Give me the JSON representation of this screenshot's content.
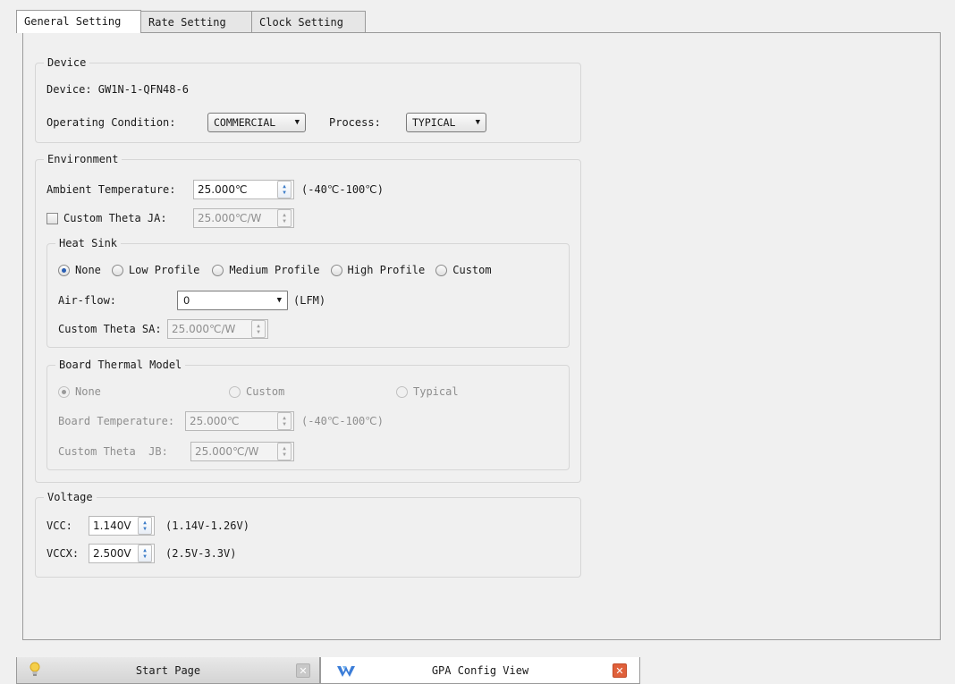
{
  "tabs": [
    {
      "label": "General Setting"
    },
    {
      "label": "Rate Setting"
    },
    {
      "label": "Clock Setting"
    }
  ],
  "device": {
    "title": "Device",
    "device_text": "Device: GW1N-1-QFN48-6",
    "operating_label": "Operating Condition:",
    "operating_value": "COMMERCIAL",
    "process_label": "Process:",
    "process_value": "TYPICAL"
  },
  "environment": {
    "title": "Environment",
    "ambient_label": "Ambient Temperature:",
    "ambient_value": "25.000℃",
    "ambient_range": "(-40℃-100℃)",
    "theta_ja_label": "Custom Theta JA:",
    "theta_ja_value": "25.000℃/W",
    "heat_sink": {
      "title": "Heat Sink",
      "options": [
        "None",
        "Low Profile",
        "Medium Profile",
        "High Profile",
        "Custom"
      ],
      "selected": "None",
      "airflow_label": "Air-flow:",
      "airflow_value": "0",
      "airflow_unit": "(LFM)",
      "theta_sa_label": "Custom Theta SA:",
      "theta_sa_value": "25.000℃/W"
    },
    "board": {
      "title": "Board Thermal Model",
      "options": [
        "None",
        "Custom",
        "Typical"
      ],
      "selected": "None",
      "temp_label": "Board Temperature:",
      "temp_value": "25.000℃",
      "temp_range": "(-40℃-100℃)",
      "theta_jb_label": "Custom Theta  JB:",
      "theta_jb_value": "25.000℃/W"
    }
  },
  "voltage": {
    "title": "Voltage",
    "vcc_label": "VCC:",
    "vcc_value": "1.140V",
    "vcc_range": "(1.14V-1.26V)",
    "vccx_label": "VCCX:",
    "vccx_value": "2.500V",
    "vccx_range": "(2.5V-3.3V)"
  },
  "bottom_tabs": [
    {
      "label": "Start Page",
      "icon": "lightbulb-icon"
    },
    {
      "label": "GPA Config View",
      "icon": "gowin-logo-icon"
    }
  ],
  "colors": {
    "accent": "#2a5fb4",
    "close_red": "#e0603a"
  }
}
